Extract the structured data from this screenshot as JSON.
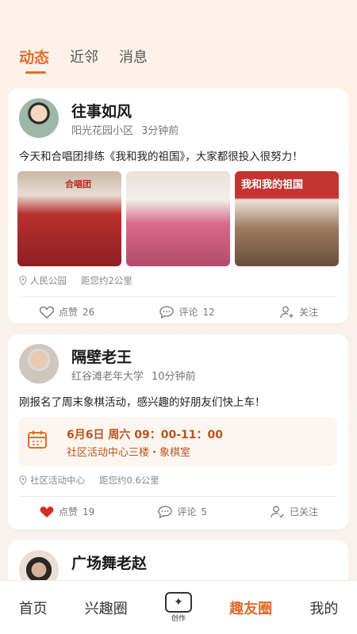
{
  "top_tabs": [
    "动态",
    "近邻",
    "消息"
  ],
  "posts": [
    {
      "name": "往事如风",
      "community": "阳光花园小区",
      "time": "3分钟前",
      "text": "今天和合唱团排练《我和我的祖国》，大家都很投入很努力！",
      "photo_banners": [
        "合唱团",
        "",
        "我和我的祖国"
      ],
      "location": "人民公园",
      "distance": "距您约2公里",
      "like_label": "点赞",
      "like_count": "26",
      "comment_label": "评论",
      "comment_count": "12",
      "follow_label": "关注"
    },
    {
      "name": "隔壁老王",
      "community": "红谷滩老年大学",
      "time": "10分钟前",
      "text": "刚报名了周末象棋活动，感兴趣的好朋友们快上车！",
      "event_line1": "6月6日  周六  09：00-11：00",
      "event_line2": "社区活动中心三楼・象棋室",
      "location": "社区活动中心",
      "distance": "距您约0.6公里",
      "like_label": "点赞",
      "like_count": "19",
      "comment_label": "评论",
      "comment_count": "5",
      "follow_label": "已关注"
    },
    {
      "name": "广场舞老赵"
    }
  ],
  "bottom_nav": [
    "首页",
    "兴趣圈",
    "创作",
    "趣友圈",
    "我的"
  ],
  "colors": {
    "accent": "#e36a2c",
    "like_red": "#d62b2b"
  }
}
